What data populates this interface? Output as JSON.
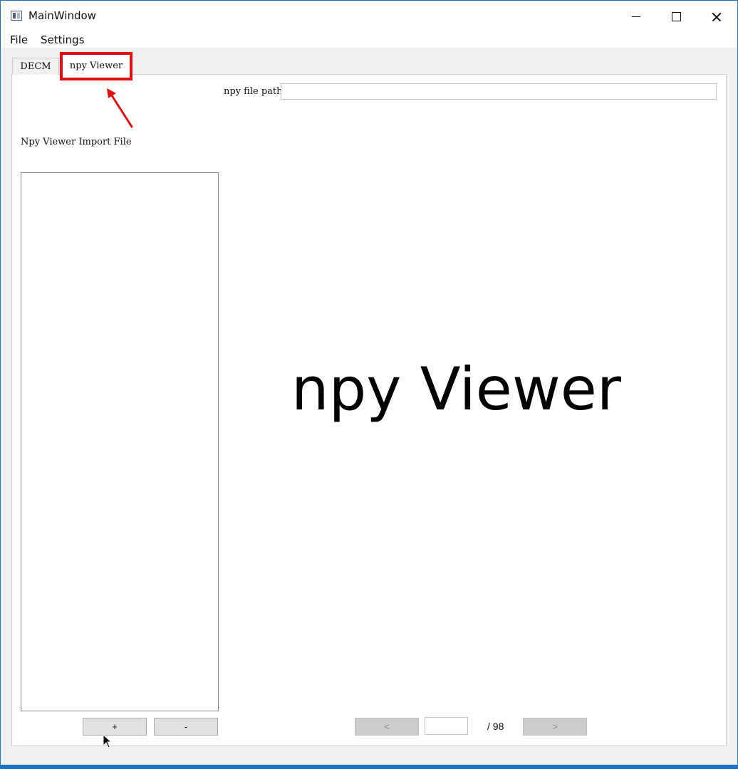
{
  "window": {
    "title": "MainWindow"
  },
  "menu": {
    "file": "File",
    "settings": "Settings"
  },
  "tabs": [
    {
      "label": "DECM",
      "active": false
    },
    {
      "label": "npy Viewer",
      "active": true
    }
  ],
  "npy_viewer": {
    "path_label": "npy file path",
    "path_value": "",
    "import_label": "Npy Viewer Import File",
    "add_label": "+",
    "remove_label": "-",
    "viewer_text": "npy Viewer",
    "prev_label": "<",
    "next_label": ">",
    "page_current": "",
    "page_total": "/ 98"
  },
  "annotation": {
    "highlight_color": "#e01010",
    "arrow_color": "#e01010"
  },
  "icons": {
    "app": "app-window-icon",
    "minimize": "minimize-icon",
    "maximize": "maximize-icon",
    "close": "close-icon",
    "cursor": "mouse-cursor-icon"
  }
}
